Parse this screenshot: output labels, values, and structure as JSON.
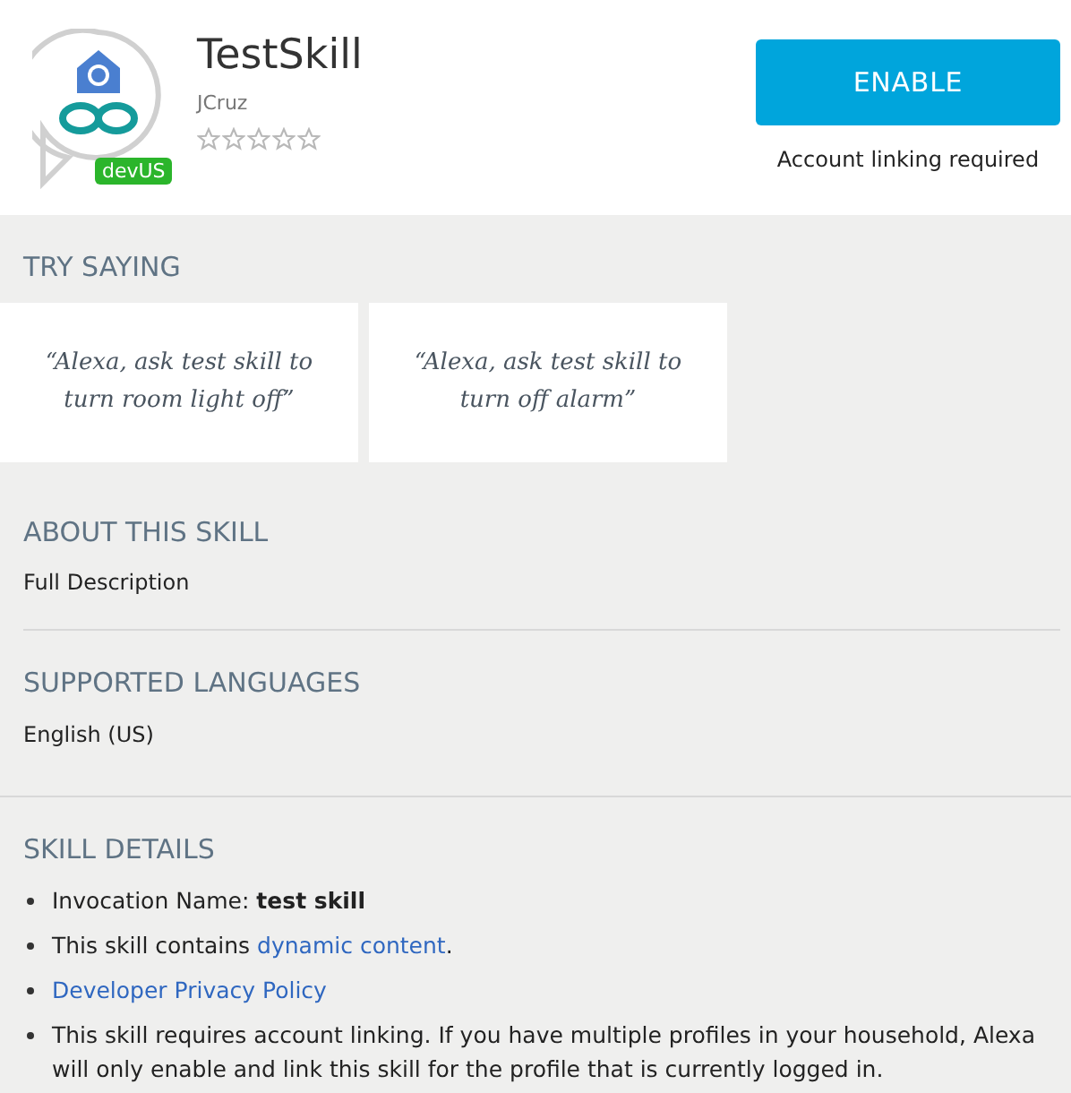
{
  "skill": {
    "name": "TestSkill",
    "badge": "devUS",
    "developer": "JCruz",
    "stars": 0
  },
  "enable_button": "ENABLE",
  "account_note": "Account linking required",
  "try_saying": {
    "title": "TRY SAYING",
    "utterances": [
      "“Alexa, ask test skill to turn room light off”",
      "“Alexa, ask test skill to turn off alarm”"
    ]
  },
  "about": {
    "title": "ABOUT THIS SKILL",
    "link": "Full Description"
  },
  "languages": {
    "title": "SUPPORTED LANGUAGES",
    "value": "English (US)"
  },
  "details": {
    "title": "SKILL DETAILS",
    "items": [
      {
        "parts": [
          {
            "text": "Invocation Name: **test skill**",
            "link": false
          }
        ]
      },
      {
        "parts": [
          {
            "text": "This skill contains ",
            "link": false
          },
          {
            "text": "dynamic content",
            "link": true
          },
          {
            "text": ".",
            "link": false
          }
        ]
      },
      {
        "parts": [
          {
            "text": "Developer Privacy Policy",
            "link": true
          }
        ]
      },
      {
        "parts": [
          {
            "text": "This skill requires account linking. If you have multiple profiles in your household, Alexa will only enable and link this skill for the profile that is currently logged in.",
            "link": false
          }
        ]
      }
    ]
  }
}
